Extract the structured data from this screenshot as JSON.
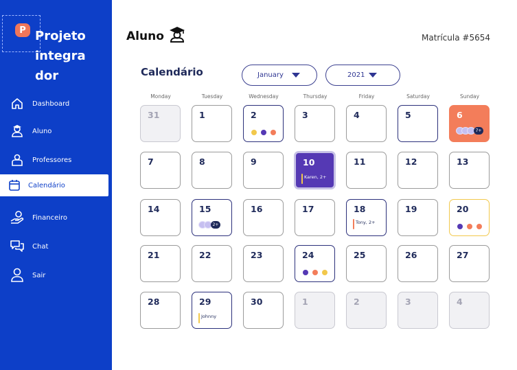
{
  "app": {
    "logo_letter": "P",
    "brand": "Projeto integra dor"
  },
  "sidebar": {
    "items": [
      {
        "label": "Dashboard",
        "icon": "home-icon"
      },
      {
        "label": "Aluno",
        "icon": "student-icon"
      },
      {
        "label": "Professores",
        "icon": "teacher-icon"
      },
      {
        "label": "Calendário",
        "icon": "calendar-icon",
        "active": true
      },
      {
        "label": "Financeiro",
        "icon": "money-hand-icon"
      },
      {
        "label": "Chat",
        "icon": "chat-icon"
      },
      {
        "label": "Sair",
        "icon": "user-icon"
      }
    ]
  },
  "header": {
    "title": "Aluno",
    "title_icon": "graduation-cap-icon",
    "matricula": "Matrícula #5654"
  },
  "calendar": {
    "title": "Calendário",
    "month": "January",
    "year": "2021",
    "weekdays": [
      "Monday",
      "Tuesday",
      "Wednesday",
      "Thursday",
      "Friday",
      "Saturday",
      "Sunday"
    ],
    "colors": {
      "brand": "#0d3fc8",
      "purple": "#5539b4",
      "orange": "#f37d5a",
      "yellow": "#f2c84b",
      "navy": "#2a2f7a"
    },
    "weeks": [
      [
        {
          "day": "31",
          "muted": true
        },
        {
          "day": "1"
        },
        {
          "day": "2"
        },
        {
          "day": "3"
        },
        {
          "day": "4"
        },
        {
          "day": "5"
        },
        {
          "day": "6"
        }
      ],
      [
        {
          "day": "7"
        },
        {
          "day": "8"
        },
        {
          "day": "9"
        },
        {
          "day": "10"
        },
        {
          "day": "11"
        },
        {
          "day": "12"
        },
        {
          "day": "13"
        }
      ],
      [
        {
          "day": "14"
        },
        {
          "day": "15"
        },
        {
          "day": "16"
        },
        {
          "day": "17"
        },
        {
          "day": "18"
        },
        {
          "day": "19"
        },
        {
          "day": "20"
        }
      ],
      [
        {
          "day": "21"
        },
        {
          "day": "22"
        },
        {
          "day": "23"
        },
        {
          "day": "24"
        },
        {
          "day": "25"
        },
        {
          "day": "26"
        },
        {
          "day": "27"
        }
      ],
      [
        {
          "day": "28"
        },
        {
          "day": "29"
        },
        {
          "day": "30"
        },
        {
          "day": "1",
          "muted": true
        },
        {
          "day": "2",
          "muted": true
        },
        {
          "day": "3",
          "muted": true
        },
        {
          "day": "4",
          "muted": true
        }
      ]
    ],
    "events": {
      "jan6": {
        "more": "7+"
      },
      "jan10": {
        "note": "Karen, 2+"
      },
      "jan15": {
        "more": "2+"
      },
      "jan18": {
        "note": "Tony, 2+"
      },
      "jan29": {
        "note": "Johnny"
      }
    }
  }
}
